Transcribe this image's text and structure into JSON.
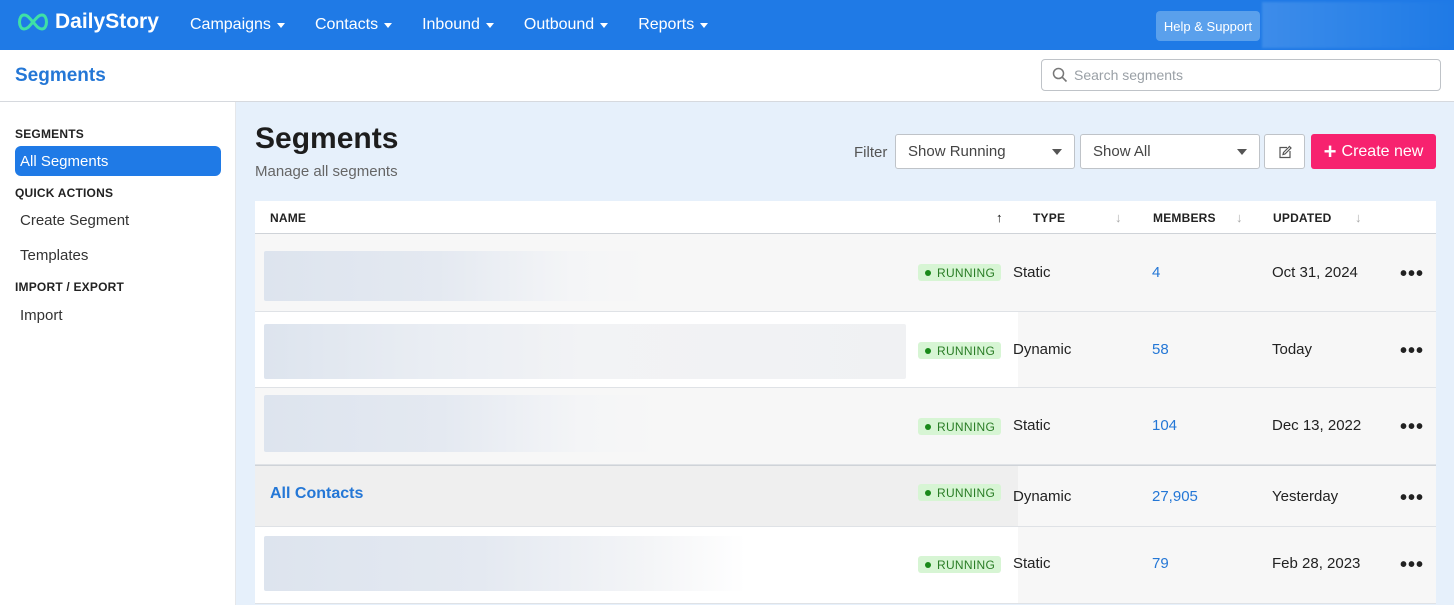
{
  "brand": {
    "name": "DailyStory"
  },
  "nav": {
    "items": [
      {
        "label": "Campaigns"
      },
      {
        "label": "Contacts"
      },
      {
        "label": "Inbound"
      },
      {
        "label": "Outbound"
      },
      {
        "label": "Reports"
      }
    ],
    "help_label": "Help & Support"
  },
  "subheader": {
    "title": "Segments",
    "search_placeholder": "Search segments"
  },
  "sidebar": {
    "sections": [
      {
        "heading": "SEGMENTS",
        "items": [
          {
            "label": "All Segments",
            "active": true
          }
        ]
      },
      {
        "heading": "QUICK ACTIONS",
        "items": [
          {
            "label": "Create Segment"
          },
          {
            "label": "Templates"
          }
        ]
      },
      {
        "heading": "IMPORT / EXPORT",
        "items": [
          {
            "label": "Import"
          }
        ]
      }
    ]
  },
  "main": {
    "title": "Segments",
    "subtitle": "Manage all segments",
    "filter_label": "Filter",
    "status_filter": "Show Running",
    "scope_filter": "Show All",
    "create_label": "Create new"
  },
  "table": {
    "columns": {
      "name": "NAME",
      "type": "TYPE",
      "members": "MEMBERS",
      "updated": "UPDATED"
    },
    "sort_arrow_up": "↑",
    "sort_arrow_down": "↓",
    "rows": [
      {
        "name": "",
        "status": "RUNNING",
        "type": "Static",
        "members": "4",
        "updated": "Oct 31, 2024"
      },
      {
        "name": "",
        "status": "RUNNING",
        "type": "Dynamic",
        "members": "58",
        "updated": "Today"
      },
      {
        "name": "",
        "status": "RUNNING",
        "type": "Static",
        "members": "104",
        "updated": "Dec 13, 2022"
      },
      {
        "name": "All Contacts",
        "status": "RUNNING",
        "type": "Dynamic",
        "members": "27,905",
        "updated": "Yesterday"
      },
      {
        "name": "",
        "status": "RUNNING",
        "type": "Static",
        "members": "79",
        "updated": "Feb 28, 2023"
      }
    ],
    "row_menu": "•••"
  },
  "colors": {
    "nav_bg": "#1f7ae6",
    "accent": "#2477d6",
    "create_btn": "#f7226f",
    "badge_bg": "#d7f5d4",
    "badge_text": "#2a7d26",
    "main_bg": "#e6f0fb"
  }
}
